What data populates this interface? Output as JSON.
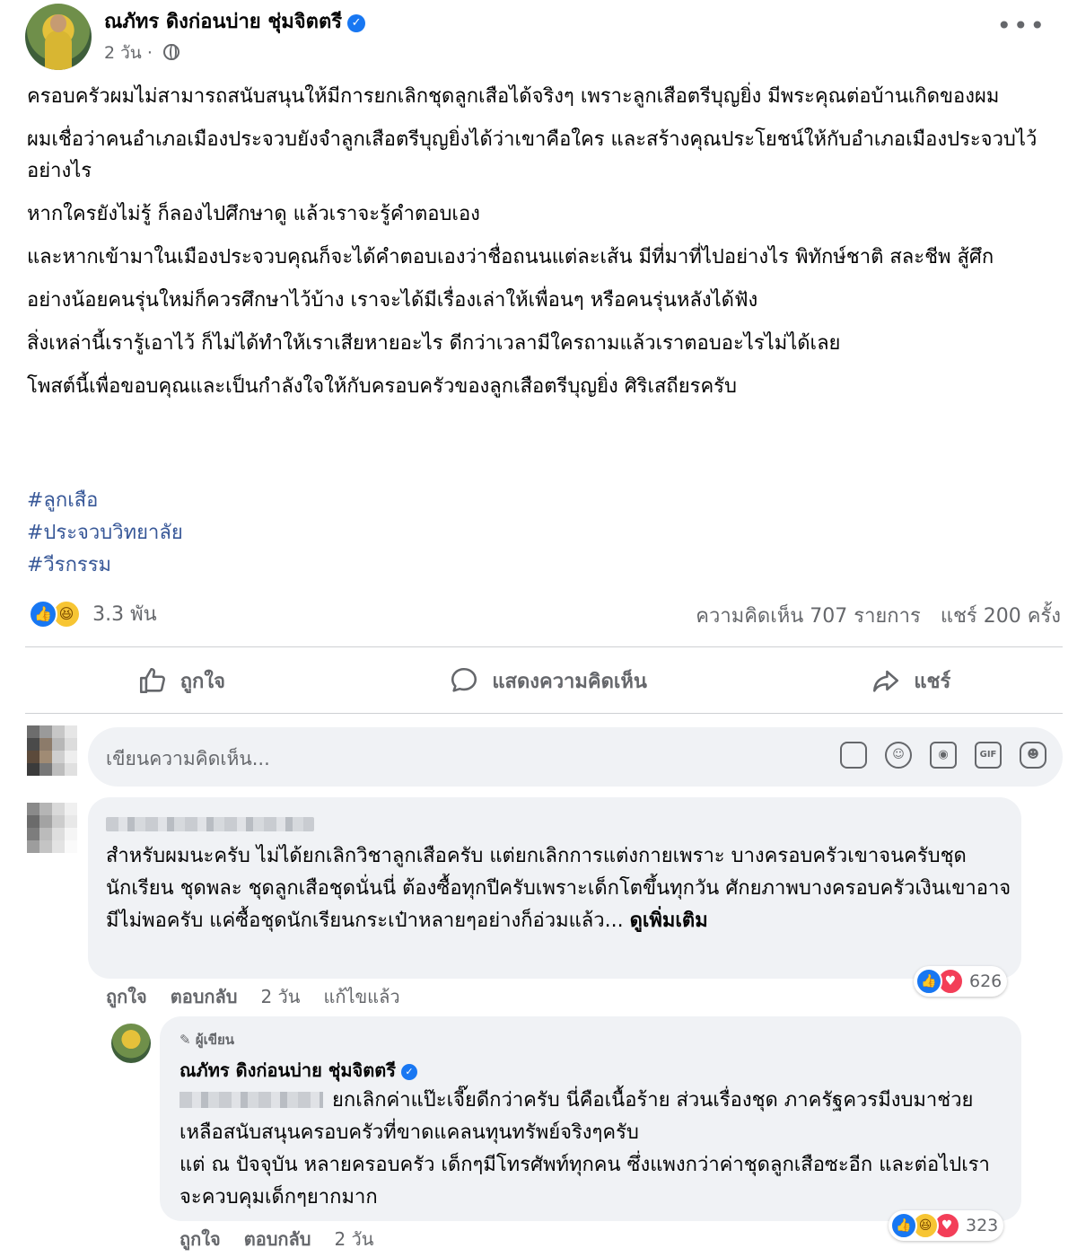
{
  "post": {
    "author": "ณภัทร ดิงก่อนบ่าย ชุ่มจิตตรี",
    "time": "2 วัน",
    "verified_icon": "verified-badge-icon",
    "privacy_icon": "globe-icon",
    "more_label": "•••",
    "paragraphs": [
      "ครอบครัวผมไม่สามารถสนับสนุนให้มีการยกเลิกชุดลูกเสือได้จริงๆ เพราะลูกเสือตรีบุญยิ่ง มีพระคุณต่อบ้านเกิดของผม",
      "ผมเชื่อว่าคนอำเภอเมืองประจวบยังจำลูกเสือตรีบุญยิ่งได้ว่าเขาคือใคร และสร้างคุณประโยชน์ให้กับอำเภอเมืองประจวบไว้อย่างไร",
      "หากใครยังไม่รู้ ก็ลองไปศึกษาดู แล้วเราจะรู้คำตอบเอง",
      "และหากเข้ามาในเมืองประจวบคุณก็จะได้คำตอบเองว่าชื่อถนนแต่ละเส้น มีที่มาที่ไปอย่างไร พิทักษ์ชาติ สละชีพ สู้ศึก",
      "อย่างน้อยคนรุ่นใหม่ก็ควรศึกษาไว้บ้าง เราจะได้มีเรื่องเล่าให้เพื่อนๆ หรือคนรุ่นหลังได้ฟัง",
      "สิ่งเหล่านี้เรารู้เอาไว้ ก็ไม่ได้ทำให้เราเสียหายอะไร ดีกว่าเวลามีใครถามแล้วเราตอบอะไรไม่ได้เลย",
      "โพสต์นี้เพื่อขอบคุณและเป็นกำลังใจให้กับครอบครัวของลูกเสือตรีบุญยิ่ง ศิริเสถียรครับ"
    ],
    "hashtags": [
      "#ลูกเสือ",
      "#ประจวบวิทยาลัย",
      "#วีรกรรม"
    ],
    "reaction_count": "3.3 พัน",
    "comments_count": "ความคิดเห็น 707 รายการ",
    "shares_count": "แชร์ 200 ครั้ง"
  },
  "actions": {
    "like": "ถูกใจ",
    "comment": "แสดงความคิดเห็น",
    "share": "แชร์"
  },
  "comment_input": {
    "placeholder": "เขียนความคิดเห็น...",
    "icons": [
      "sticker-icon",
      "emoji-icon",
      "camera-icon",
      "gif-icon",
      "avatar-sticker-icon"
    ],
    "gif_label": "GIF"
  },
  "comment1": {
    "text": "สำหรับผมนะครับ ไม่ได้ยกเลิกวิชาลูกเสือครับ แต่ยกเลิกการแต่งกายเพราะ บางครอบครัวเขาจนครับชุดนักเรียน ชุดพละ ชุดลูกเสือชุดนั่นนี่ ต้องซื้อทุกปีครับเพราะเด็กโตขึ้นทุกวัน ศักยภาพบางครอบครัวเงินเขาอาจมีไม่พอครับ แค่ซื้อชุดนักเรียนกระเป๋าหลายๆอย่างก็อ่วมแล้ว...",
    "see_more": "ดูเพิ่มเติม",
    "like": "ถูกใจ",
    "reply": "ตอบกลับ",
    "time": "2 วัน",
    "edited": "แก้ไขแล้ว",
    "reaction_count": "626"
  },
  "reply1": {
    "badge": "ผู้เขียน",
    "author": "ณภัทร ดิงก่อนบ่าย ชุ่มจิตตรี",
    "text_line1": "ยกเลิกค่าแป๊ะเจี๊ยดีกว่าครับ นี่คือเนื้อร้าย ส่วนเรื่องชุด ภาครัฐควรมีงบมาช่วยเหลือสนับสนุนครอบครัวที่ขาดแคลนทุนทรัพย์จริงๆครับ",
    "text_line2": "แต่ ณ ปัจจุบัน หลายครอบครัว เด็กๆมีโทรศัพท์ทุกคน ซึ่งแพงกว่าค่าชุดลูกเสือซะอีก และต่อไปเราจะควบคุมเด็กๆยากมาก",
    "like": "ถูกใจ",
    "reply": "ตอบกลับ",
    "time": "2 วัน",
    "reaction_count": "323"
  },
  "colors": {
    "accent": "#1877f2",
    "hashtag": "#385898",
    "muted": "#65676b",
    "bubble": "#f0f2f5"
  }
}
